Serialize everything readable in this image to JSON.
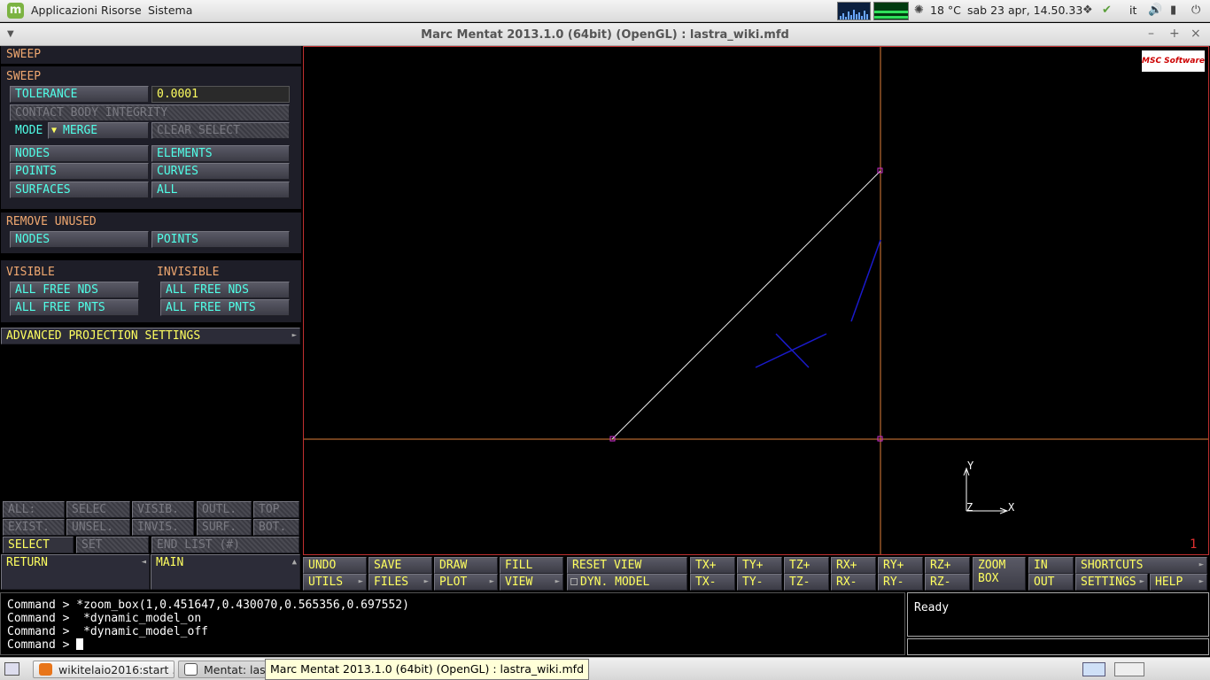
{
  "top_panel": {
    "menu": [
      "Applicazioni",
      "Risorse",
      "Sistema"
    ],
    "temperature": "18 °C",
    "datetime": "sab 23 apr, 14.50.33",
    "keyboard_layout": "it"
  },
  "window": {
    "title": "Marc Mentat 2013.1.0 (64bit) (OpenGL) : lastra_wiki.mfd"
  },
  "left_panel": {
    "header": "SWEEP",
    "sweep": {
      "title": "SWEEP",
      "tolerance_label": "TOLERANCE",
      "tolerance_value": "0.0001",
      "contact_body_integrity": "CONTACT BODY INTEGRITY",
      "mode_label": "MODE",
      "mode_value": "MERGE",
      "clear_select": "CLEAR SELECT",
      "nodes": "NODES",
      "elements": "ELEMENTS",
      "points": "POINTS",
      "curves": "CURVES",
      "surfaces": "SURFACES",
      "all": "ALL"
    },
    "remove_unused": {
      "title": "REMOVE UNUSED",
      "nodes": "NODES",
      "points": "POINTS"
    },
    "visible": {
      "title": "VISIBLE",
      "free_nds": "ALL FREE NDS",
      "free_pnts": "ALL FREE PNTS"
    },
    "invisible": {
      "title": "INVISIBLE",
      "free_nds": "ALL FREE NDS",
      "free_pnts": "ALL FREE PNTS"
    },
    "advanced": "ADVANCED PROJECTION SETTINGS",
    "list_row1": [
      "ALL:",
      "SELEC",
      "VISIB.",
      "OUTL.",
      "TOP"
    ],
    "list_row2": [
      "EXIST.",
      "UNSEL.",
      "INVIS.",
      "SURF.",
      "BOT."
    ],
    "select": "SELECT",
    "set": "SET",
    "end_list": "END LIST (#)",
    "return": "RETURN",
    "main": "MAIN"
  },
  "viewport": {
    "logo_text": "MSC Software",
    "axis_x": "X",
    "axis_y": "Y",
    "axis_z": "Z",
    "index": "1"
  },
  "toolbar": {
    "undo": "UNDO",
    "save": "SAVE",
    "draw": "DRAW",
    "fill": "FILL",
    "reset_view": "RESET VIEW",
    "utils": "UTILS",
    "files": "FILES",
    "plot": "PLOT",
    "view": "VIEW",
    "dyn_model": "DYN. MODEL",
    "tx_plus": "TX+",
    "ty_plus": "TY+",
    "tz_plus": "TZ+",
    "rx_plus": "RX+",
    "ry_plus": "RY+",
    "rz_plus": "RZ+",
    "tx_minus": "TX-",
    "ty_minus": "TY-",
    "tz_minus": "TZ-",
    "rx_minus": "RX-",
    "ry_minus": "RY-",
    "rz_minus": "RZ-",
    "zoom": "ZOOM",
    "box": "BOX",
    "in": "IN",
    "out": "OUT",
    "shortcuts": "SHORTCUTS",
    "settings": "SETTINGS",
    "help": "HELP"
  },
  "command": {
    "lines": [
      "Command > *zoom_box(1,0.451647,0.430070,0.565356,0.697552)",
      "Command >  *dynamic_model_on",
      "Command >  *dynamic_model_off",
      "Command > "
    ]
  },
  "status": "Ready",
  "taskbar": {
    "tasks": [
      "wikitelaio2016:start ...",
      "Mentat: last"
    ],
    "tooltip": "Marc Mentat 2013.1.0 (64bit) (OpenGL) : lastra_wiki.mfd"
  }
}
